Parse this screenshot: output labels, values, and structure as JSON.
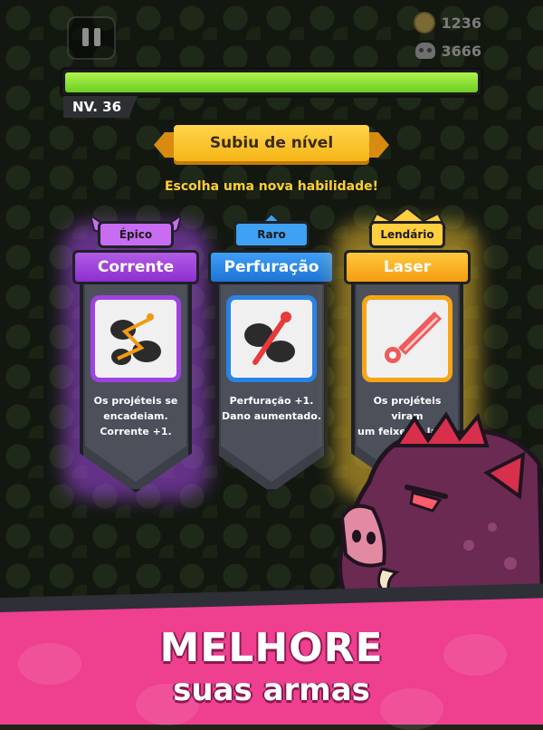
{
  "hud": {
    "coins": "1236",
    "kills": "3666",
    "xp_fraction": 1.0,
    "level_label": "NV. 36"
  },
  "levelup": {
    "banner": "Subiu de nível",
    "subtitle": "Escolha uma nova habilidade!"
  },
  "cards": [
    {
      "rarity": "Épico",
      "title": "Corrente",
      "icon": "chain-projectile-icon",
      "desc": [
        "Os projéteis se",
        "encadeiam.",
        "Corrente +1."
      ]
    },
    {
      "rarity": "Raro",
      "title": "Perfuração",
      "icon": "pierce-projectile-icon",
      "desc": [
        "Perfuração +1.",
        "Dano aumentado."
      ]
    },
    {
      "rarity": "Lendário",
      "title": "Laser",
      "icon": "laser-beam-icon",
      "desc": [
        "Os projéteis viram",
        "um feixe de laser."
      ]
    }
  ],
  "promo": {
    "headline": "MELHORE",
    "subline": "suas armas"
  },
  "colors": {
    "epic": "#a042e0",
    "rare": "#2a83e4",
    "legendary": "#f5a516",
    "xp": "#7ad82f",
    "promo_bg": "#ef3f8f"
  }
}
